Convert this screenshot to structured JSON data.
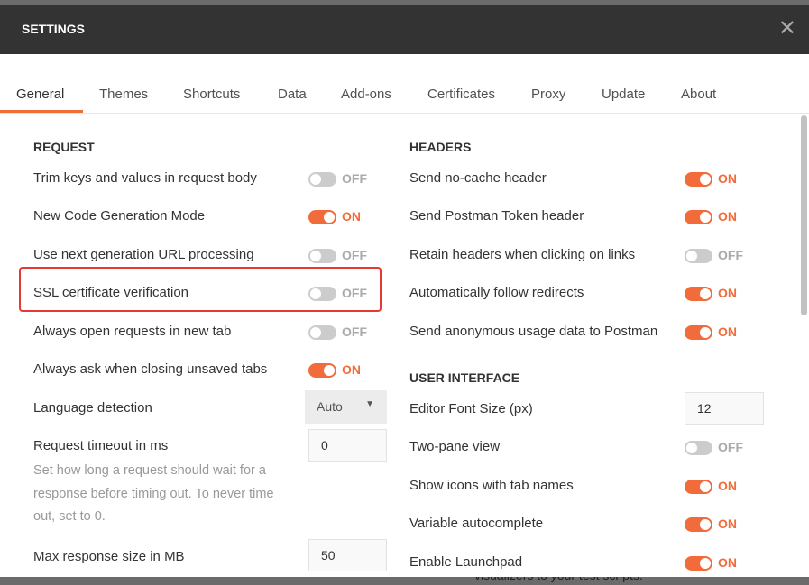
{
  "title": "SETTINGS",
  "background_text": "visualizers to your test scripts.",
  "tabs": [
    "General",
    "Themes",
    "Shortcuts",
    "Data",
    "Add-ons",
    "Certificates",
    "Proxy",
    "Update",
    "About"
  ],
  "request": {
    "heading": "REQUEST",
    "items": [
      {
        "label": "Trim keys and values in request body",
        "state": "OFF"
      },
      {
        "label": "New Code Generation Mode",
        "state": "ON"
      },
      {
        "label": "Use next generation URL processing",
        "state": "OFF"
      },
      {
        "label": "SSL certificate verification",
        "state": "OFF"
      },
      {
        "label": "Always open requests in new tab",
        "state": "OFF"
      },
      {
        "label": "Always ask when closing unsaved tabs",
        "state": "ON"
      }
    ],
    "language": {
      "label": "Language detection",
      "value": "Auto"
    },
    "timeout": {
      "label": "Request timeout in ms",
      "value": "0",
      "help": "Set how long a request should wait for a response before timing out. To never time out, set to 0."
    },
    "max_size": {
      "label": "Max response size in MB",
      "value": "50"
    }
  },
  "headers": {
    "heading": "HEADERS",
    "items": [
      {
        "label": "Send no-cache header",
        "state": "ON"
      },
      {
        "label": "Send Postman Token header",
        "state": "ON"
      },
      {
        "label": "Retain headers when clicking on links",
        "state": "OFF"
      },
      {
        "label": "Automatically follow redirects",
        "state": "ON"
      },
      {
        "label": "Send anonymous usage data to Postman",
        "state": "ON"
      }
    ]
  },
  "ui": {
    "heading": "USER INTERFACE",
    "font_size": {
      "label": "Editor Font Size (px)",
      "value": "12"
    },
    "items": [
      {
        "label": "Two-pane view",
        "state": "OFF"
      },
      {
        "label": "Show icons with tab names",
        "state": "ON"
      },
      {
        "label": "Variable autocomplete",
        "state": "ON"
      },
      {
        "label": "Enable Launchpad",
        "state": "ON"
      }
    ]
  },
  "colors": {
    "accent": "#f26b3a",
    "header": "#333333",
    "highlight": "#e53935"
  }
}
